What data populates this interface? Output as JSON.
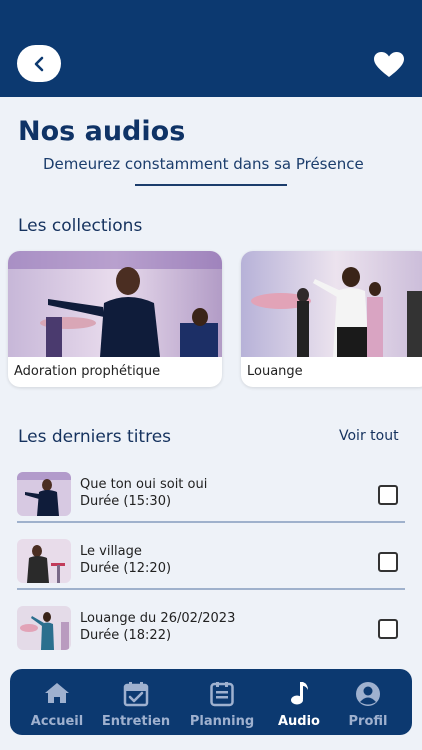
{
  "header": {
    "back_icon": "chevron-left-icon",
    "favorite_icon": "heart-icon"
  },
  "page": {
    "title": "Nos audios",
    "subtitle": "Demeurez constamment dans sa Présence"
  },
  "collections": {
    "title": "Les collections",
    "items": [
      {
        "label": "Adoration prophétique"
      },
      {
        "label": "Louange"
      }
    ]
  },
  "latest": {
    "title": "Les derniers titres",
    "see_all": "Voir tout",
    "tracks": [
      {
        "title": "Que ton oui soit oui",
        "duration": "Durée (15:30)"
      },
      {
        "title": "Le village",
        "duration": "Durée (12:20)"
      },
      {
        "title": "Louange du 26/02/2023",
        "duration": "Durée (18:22)"
      }
    ]
  },
  "nav": {
    "active": "Audio",
    "tabs": [
      {
        "label": "Accueil",
        "icon": "home-icon"
      },
      {
        "label": "Entretien",
        "icon": "calendar-check-icon"
      },
      {
        "label": "Planning",
        "icon": "list-icon"
      },
      {
        "label": "Audio",
        "icon": "music-note-icon"
      },
      {
        "label": "Profil",
        "icon": "user-icon"
      }
    ]
  },
  "colors": {
    "primary": "#0c3970",
    "background": "#eef2f8",
    "text": "#15325e"
  }
}
